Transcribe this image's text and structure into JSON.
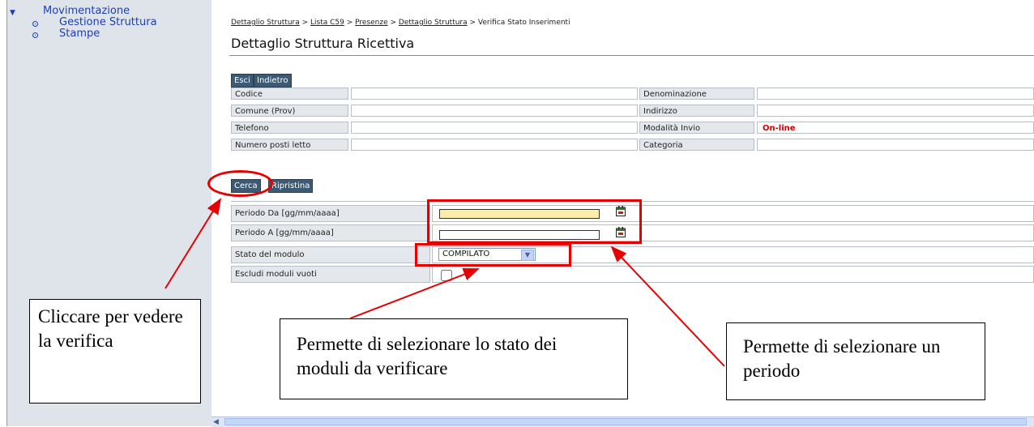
{
  "sidebar": {
    "items": [
      {
        "label": "Movimentazione"
      },
      {
        "label": "Gestione Struttura"
      },
      {
        "label": "Stampe"
      }
    ]
  },
  "breadcrumb": {
    "items": [
      "Dettaglio Struttura",
      "Lista C59",
      "Presenze",
      "Dettaglio Struttura"
    ],
    "separator": " > ",
    "current": "Verifica Stato Inserimenti"
  },
  "page": {
    "title": "Dettaglio Struttura Ricettiva"
  },
  "toolbar": {
    "exit_label": "Esci",
    "back_label": "Indietro"
  },
  "info": {
    "rows": [
      {
        "label1": "Codice",
        "value1": "",
        "label2": "Denominazione",
        "value2": ""
      },
      {
        "label1": "Comune (Prov)",
        "value1": "",
        "label2": "Indirizzo",
        "value2": ""
      },
      {
        "label1": "Telefono",
        "value1": "",
        "label2": "Modalità Invio",
        "value2": "On-line"
      },
      {
        "label1": "Numero posti letto",
        "value1": "",
        "label2": "Categoria",
        "value2": ""
      }
    ]
  },
  "search": {
    "search_label": "Cerca",
    "reset_label": "Ripristina"
  },
  "filters": {
    "from_label": "Periodo Da [gg/mm/aaaa]",
    "from_value": "",
    "to_label": "Periodo A [gg/mm/aaaa]",
    "to_value": "",
    "state_label": "Stato del modulo",
    "state_value": "COMPILATO",
    "exclude_label": "Escludi moduli vuoti"
  },
  "notes": {
    "click": "Cliccare per vedere la verifica",
    "state": "Permette di selezionare lo stato dei moduli da verificare",
    "period": "Permette di selezionare un periodo"
  },
  "colors": {
    "highlight": "#e60000",
    "sidebar_bg": "#dfe4ea",
    "button_bg": "#3d5a74",
    "date_input": "#fbeeaa"
  },
  "icons": [
    "expand-arrow-icon",
    "bullet-icon",
    "calendar-icon",
    "chevron-down-icon",
    "scroll-left-icon"
  ]
}
